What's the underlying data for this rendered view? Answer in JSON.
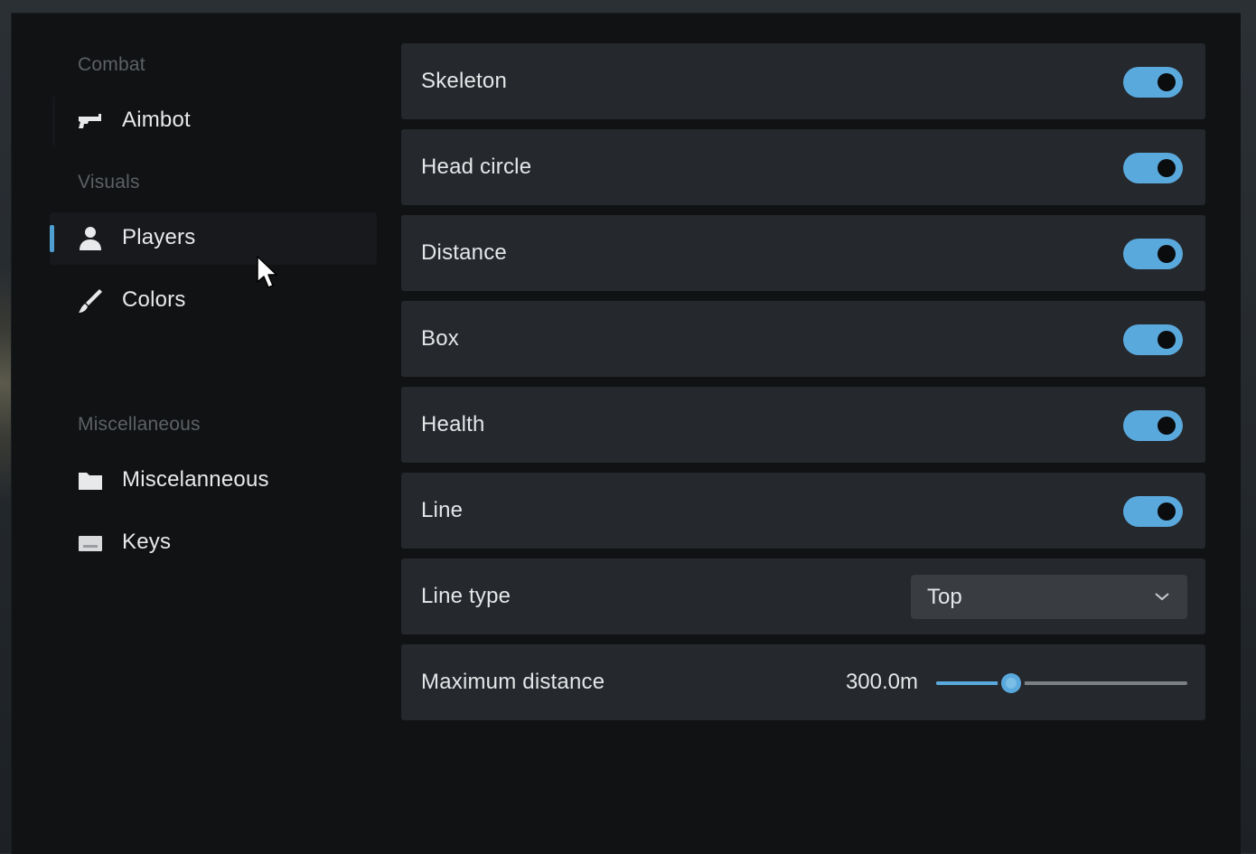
{
  "sidebar": {
    "sections": [
      {
        "title": "Combat"
      },
      {
        "title": "Visuals"
      },
      {
        "title": "Miscellaneous"
      }
    ],
    "items": [
      {
        "label": "Aimbot",
        "icon": "gun-icon",
        "active": false
      },
      {
        "label": "Players",
        "icon": "user-icon",
        "active": true
      },
      {
        "label": "Colors",
        "icon": "brush-icon",
        "active": false
      },
      {
        "label": "Miscelanneous",
        "icon": "folder-icon",
        "active": false
      },
      {
        "label": "Keys",
        "icon": "keyboard-icon",
        "active": false
      }
    ]
  },
  "settings": {
    "toggles": [
      {
        "label": "Skeleton",
        "on": true
      },
      {
        "label": "Head circle",
        "on": true
      },
      {
        "label": "Distance",
        "on": true
      },
      {
        "label": "Box",
        "on": true
      },
      {
        "label": "Health",
        "on": true
      },
      {
        "label": "Line",
        "on": true
      }
    ],
    "line_type": {
      "label": "Line type",
      "value": "Top"
    },
    "max_distance": {
      "label": "Maximum distance",
      "value_text": "300.0m",
      "fraction": 0.3
    }
  },
  "colors": {
    "accent": "#5aa9dd",
    "panel_bg": "#101214",
    "row_bg": "#25282c"
  }
}
